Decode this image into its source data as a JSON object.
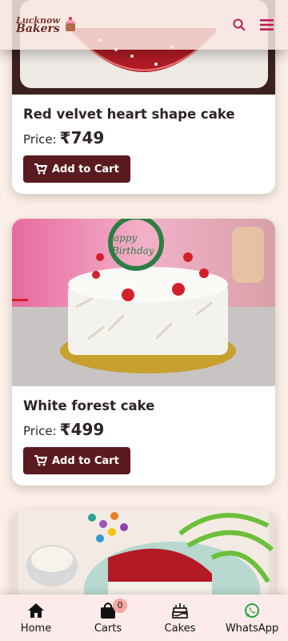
{
  "header": {
    "logo_line1": "Lucknow",
    "logo_line2": "Bakers",
    "accent_color": "#c2185b"
  },
  "products": [
    {
      "title": "Red velvet heart shape cake",
      "price_label": "Price:",
      "price": "₹749",
      "button_label": "Add to Cart"
    },
    {
      "title": "White forest cake",
      "price_label": "Price:",
      "price": "₹499",
      "button_label": "Add to Cart",
      "topper_text": "Happy Birthday"
    },
    {
      "title": "",
      "price_label": "",
      "price": "",
      "button_label": ""
    }
  ],
  "bottom_nav": {
    "items": [
      {
        "label": "Home",
        "icon": "home-icon"
      },
      {
        "label": "Carts",
        "icon": "shopping-bag-icon",
        "badge": "0"
      },
      {
        "label": "Cakes",
        "icon": "cake-icon"
      },
      {
        "label": "WhatsApp",
        "icon": "whatsapp-icon"
      }
    ]
  },
  "colors": {
    "background": "#fbeee6",
    "button": "#5a1a1f",
    "whatsapp": "#25a244"
  }
}
